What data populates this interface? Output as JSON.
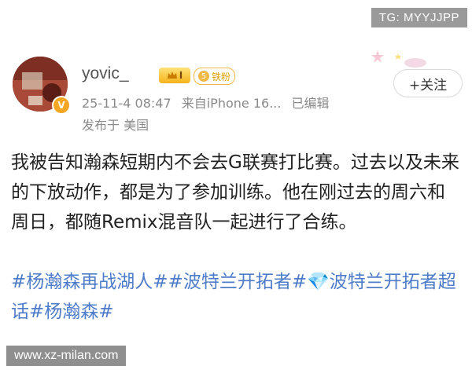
{
  "watermarks": {
    "top": "TG: MYYJJPP",
    "bottom": "www.xz-milan.com"
  },
  "post": {
    "username": "yovic_",
    "level_badge": "I",
    "fan_badge": {
      "number": "5",
      "label": "铁粉"
    },
    "meta": {
      "date": "25-11-4 08:47",
      "source": "来自iPhone 16...",
      "edited": "已编辑",
      "location": "发布于 美国"
    },
    "follow_label": "+关注",
    "text": "我被告知瀚森短期内不会去G联赛打比赛。过去以及未来的下放动作，都是为了参加训练。他在刚过去的周六和周日，都随Remix混音队一起进行了合练。",
    "hashtags": "#杨瀚森再战湖人##波特兰开拓者#💎波特兰开拓者超话#杨瀚森#"
  },
  "colors": {
    "hashtag": "#4e7cc9",
    "meta": "#8a8a8a",
    "badge_gold": "#f5b31b"
  },
  "icons": {
    "avatar": "avatar-image",
    "verify": "verified-badge-icon",
    "decoration": "stars-decoration-icon"
  }
}
